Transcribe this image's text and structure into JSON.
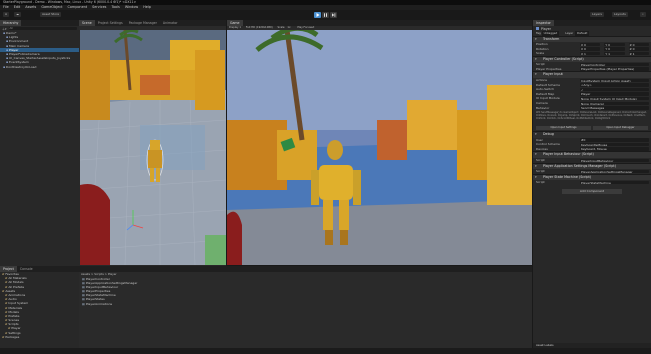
{
  "window": {
    "title": "StarterPlayground - Demo - Windows, Mac, Linux - Unity 6 (6000.0.4 6f1)* <DX11>"
  },
  "menu": [
    "File",
    "Edit",
    "Assets",
    "GameObject",
    "Component",
    "Services",
    "Tools",
    "Window",
    "Help"
  ],
  "toolbar": {
    "account": "A",
    "asset_store": "Asset Store",
    "search": "Layouts",
    "layers": "Layers",
    "cloud": "Cloud"
  },
  "hierarchy": {
    "tab": "Hierarchy",
    "search": "All",
    "rows": [
      {
        "label": "Demo*",
        "indent": 1
      },
      {
        "label": "Lights",
        "indent": 2
      },
      {
        "label": "Environment",
        "indent": 2
      },
      {
        "label": "Main Camera",
        "indent": 2
      },
      {
        "label": "Player",
        "indent": 2,
        "selected": true
      },
      {
        "label": "PlayerFollowCamera",
        "indent": 2
      },
      {
        "label": "UI_Canvas_StarterAssetsInputs_Joysticks",
        "indent": 2
      },
      {
        "label": "EventSystem",
        "indent": 2
      },
      {
        "label": "DontDestroyOnLoad",
        "indent": 1
      }
    ]
  },
  "scene_tabs": [
    "Scene",
    "Project Settings",
    "Package Manager",
    "Animator"
  ],
  "game_tab": {
    "label": "Game",
    "display": "Display 1",
    "aspect": "Full HD (1920x1080)",
    "scale": "Scale",
    "scale_value": "1x",
    "play_focused": "Play Focused"
  },
  "inspector": {
    "tab": "Inspector",
    "object_name": "Player",
    "tag": "Untagged",
    "layer": "Layer",
    "layer_value": "Default",
    "transform": {
      "title": "Transform",
      "rows": [
        {
          "label": "Position",
          "x": "0",
          "y": "0",
          "z": "0"
        },
        {
          "label": "Rotation",
          "x": "0",
          "y": "0",
          "z": "0"
        },
        {
          "label": "Scale",
          "x": "1",
          "y": "1",
          "z": "1"
        }
      ]
    },
    "player_controller": {
      "title": "Player Controller (Script)",
      "rows": [
        {
          "label": "Script",
          "value": "PlayerController"
        },
        {
          "label": "Player Properties",
          "value": "PlayerProperties (Player Properties)"
        }
      ]
    },
    "player_input": {
      "title": "Player Input",
      "rows": [
        {
          "label": "Actions",
          "value": "InputSystem (Input Action Asset)"
        },
        {
          "label": "Default Scheme",
          "value": "<Any>"
        },
        {
          "label": "Auto-Switch",
          "value": "✓"
        },
        {
          "label": "Default Map",
          "value": "Player"
        },
        {
          "label": "UI Input Module",
          "value": "None (Input System UI Input Module)"
        },
        {
          "label": "Camera",
          "value": "None (Camera)"
        },
        {
          "label": "Behavior",
          "value": "Send Messages"
        }
      ],
      "note": "Will SendMessage() to GameObject: OnDeviceLost, OnDeviceRegained, OnControlsChanged, OnMove, OnLook, OnJump, OnSprint, OnCrouch, OnInteract, OnPrevious, OnNext, OnAttack, OnPoint, OnClick, OnScrollWheel, OnMiddleClick, OnRightClick",
      "btn_settings": "Open Input Settings",
      "btn_debugger": "Open Input Debugger"
    },
    "debug": {
      "title": "Debug",
      "rows": [
        {
          "label": "User",
          "value": "#0"
        },
        {
          "label": "Control Scheme",
          "value": "Keyboard&Mouse"
        },
        {
          "label": "Devices",
          "value": "Keyboard, Mouse"
        }
      ]
    },
    "components": [
      {
        "title": "Player Input Behaviour (Script)",
        "script": "PlayerInputBehaviour"
      },
      {
        "title": "Player Application Settings Manager (Script)",
        "script": "PlayerApplicationSettingsManager"
      },
      {
        "title": "Player State Machine (Script)",
        "script": "PlayerStateMachine"
      }
    ],
    "add_component": "Add Component",
    "asset_labels": "Asset Labels"
  },
  "project": {
    "tabs": [
      "Project",
      "Console"
    ],
    "search_placeholder": "",
    "breadcrumb": "Assets > Scripts > Player",
    "tree": [
      {
        "label": "Favorites",
        "indent": 0
      },
      {
        "label": "All Materials",
        "indent": 1
      },
      {
        "label": "All Models",
        "indent": 1
      },
      {
        "label": "All Prefabs",
        "indent": 1
      },
      {
        "label": "Assets",
        "indent": 0
      },
      {
        "label": "Animations",
        "indent": 1
      },
      {
        "label": "Audio",
        "indent": 1
      },
      {
        "label": "Input System",
        "indent": 1
      },
      {
        "label": "Materials",
        "indent": 1
      },
      {
        "label": "Models",
        "indent": 1
      },
      {
        "label": "Prefabs",
        "indent": 1
      },
      {
        "label": "Scenes",
        "indent": 1
      },
      {
        "label": "Scripts",
        "indent": 1
      },
      {
        "label": "Player",
        "indent": 2
      },
      {
        "label": "Settings",
        "indent": 1
      },
      {
        "label": "Packages",
        "indent": 0
      }
    ],
    "files": [
      "PlayerController",
      "PlayerApplicationSettingsManager",
      "PlayerInputBehaviour",
      "PlayerProperties",
      "PlayerStateMachine",
      "PlayerStates",
      "PlayerAnimations"
    ]
  },
  "status_bar": {
    "text": ""
  }
}
